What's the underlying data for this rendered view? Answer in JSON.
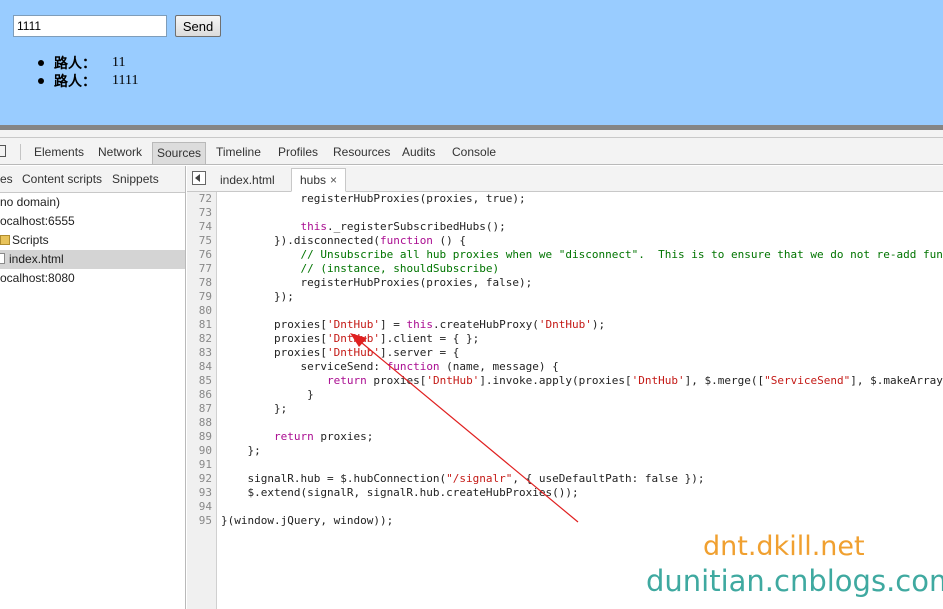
{
  "preview": {
    "input_value": "1111",
    "send_label": "Send",
    "messages": [
      {
        "name": "路人：",
        "text": "11"
      },
      {
        "name": "路人：",
        "text": "1111"
      }
    ]
  },
  "toolbar": {
    "tabs": [
      "Elements",
      "Network",
      "Sources",
      "Timeline",
      "Profiles",
      "Resources",
      "Audits",
      "Console"
    ],
    "active_tab": "Sources"
  },
  "navigator": {
    "tabs": [
      "es",
      "Content scripts",
      "Snippets"
    ],
    "tree": [
      "no domain)",
      "ocalhost:6555",
      "Scripts",
      "index.html",
      "ocalhost:8080"
    ]
  },
  "editor": {
    "tabs": [
      "index.html",
      "hubs"
    ],
    "close_glyph": "×",
    "lines": [
      {
        "n": "72",
        "t": "            registerHubProxies(proxies, true);"
      },
      {
        "n": "73",
        "t": ""
      },
      {
        "n": "74",
        "t": "            this._registerSubscribedHubs();"
      },
      {
        "n": "75",
        "t": "        }).disconnected(function () {"
      },
      {
        "n": "76",
        "t": "            // Unsubscribe all hub proxies when we \"disconnect\".  This is to ensure that we do not re-add functional call backs."
      },
      {
        "n": "77",
        "t": "            // (instance, shouldSubscribe)"
      },
      {
        "n": "78",
        "t": "            registerHubProxies(proxies, false);"
      },
      {
        "n": "79",
        "t": "        });"
      },
      {
        "n": "80",
        "t": ""
      },
      {
        "n": "81",
        "t": "        proxies['DntHub'] = this.createHubProxy('DntHub');"
      },
      {
        "n": "82",
        "t": "        proxies['DntHub'].client = { };"
      },
      {
        "n": "83",
        "t": "        proxies['DntHub'].server = {"
      },
      {
        "n": "84",
        "t": "            serviceSend: function (name, message) {"
      },
      {
        "n": "85",
        "t": "                return proxies['DntHub'].invoke.apply(proxies['DntHub'], $.merge([\"ServiceSend\"], $.makeArray(arguments)));"
      },
      {
        "n": "86",
        "t": "             }"
      },
      {
        "n": "87",
        "t": "        };"
      },
      {
        "n": "88",
        "t": ""
      },
      {
        "n": "89",
        "t": "        return proxies;"
      },
      {
        "n": "90",
        "t": "    };"
      },
      {
        "n": "91",
        "t": ""
      },
      {
        "n": "92",
        "t": "    signalR.hub = $.hubConnection(\"/signalr\", { useDefaultPath: false });"
      },
      {
        "n": "93",
        "t": "    $.extend(signalR, signalR.hub.createHubProxies());"
      },
      {
        "n": "94",
        "t": ""
      },
      {
        "n": "95",
        "t": "}(window.jQuery, window));"
      }
    ]
  },
  "watermark": {
    "line1": "dnt.dkill.net",
    "line2": "dunitian.cnblogs.com"
  },
  "colors": {
    "preview_bg": "#99ccff",
    "annotation_arrow": "#e02020"
  }
}
